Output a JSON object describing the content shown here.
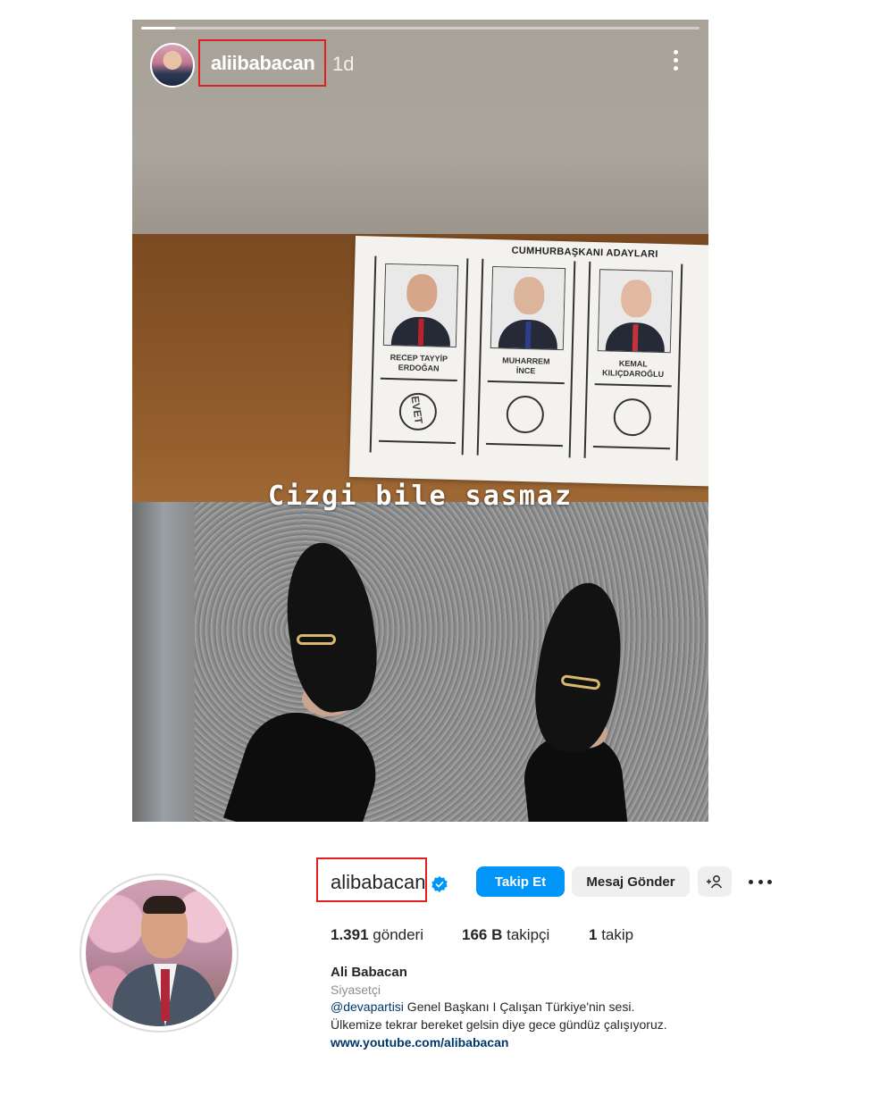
{
  "story": {
    "username": "aliibabacan",
    "time": "1d",
    "progress": 0.06,
    "caption": "Cizgi bile sasmaz",
    "ballot": {
      "title": "CUMHURBAŞKANI ADAYLARI",
      "candidates": [
        {
          "name": "RECEP TAYYİP\nERDOĞAN",
          "stamp": "EVET"
        },
        {
          "name": "MUHARREM\nİNCE",
          "stamp": ""
        },
        {
          "name": "KEMAL\nKILIÇDAROĞLU",
          "stamp": ""
        }
      ]
    },
    "icons": {
      "more": "more-vertical-icon"
    }
  },
  "profile": {
    "username": "alibabacan",
    "verified": true,
    "buttons": {
      "follow": "Takip Et",
      "message": "Mesaj Gönder",
      "suggest": "+👤"
    },
    "stats": {
      "posts_value": "1.391",
      "posts_label": "gönderi",
      "followers_value": "166 B",
      "followers_label": "takipçi",
      "following_value": "1",
      "following_label": "takip"
    },
    "full_name": "Ali Babacan",
    "category": "Siyasetçi",
    "bio_mention": "@devapartisi",
    "bio_line1_rest": " Genel Başkanı I Çalışan Türkiye'nin sesi.",
    "bio_line2": "Ülkemize tekrar bereket gelsin diye gece gündüz çalışıyoruz.",
    "link": "www.youtube.com/alibabacan",
    "colors": {
      "follow_button": "#0095f6",
      "verified": "#0095f6",
      "highlight_box": "#e02020"
    }
  }
}
